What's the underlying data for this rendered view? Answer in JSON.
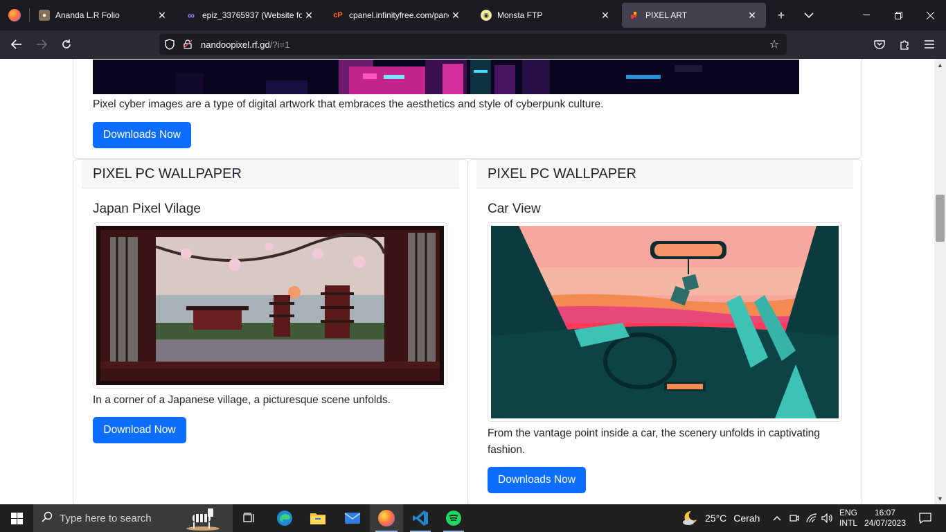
{
  "tabs": [
    {
      "title": "Ananda L.R Folio",
      "favicon": "profile-photo-icon"
    },
    {
      "title": "epiz_33765937 (Website for in",
      "favicon": "infinity-icon"
    },
    {
      "title": "cpanel.infinityfree.com/panel",
      "favicon": "cpanel-icon"
    },
    {
      "title": "Monsta FTP",
      "favicon": "monsta-icon"
    },
    {
      "title": "PIXEL ART",
      "favicon": "pixel-icon",
      "active": true
    }
  ],
  "nav": {
    "url_domain": "nandoopixel.rf.gd",
    "url_path": "/?i=1"
  },
  "page": {
    "top_card": {
      "text": "Pixel cyber images are a type of digital artwork that embraces the aesthetics and style of cyberpunk culture.",
      "button": "Downloads Now"
    },
    "left_card": {
      "header": "PIXEL PC WALLPAPER",
      "title": "Japan Pixel Vilage",
      "text": "In a corner of a Japanese village, a picturesque scene unfolds.",
      "button": "Download Now"
    },
    "right_card": {
      "header": "PIXEL PC WALLPAPER",
      "title": "Car View",
      "text": "From the vantage point inside a car, the scenery unfolds in captivating fashion.",
      "button": "Downloads Now"
    }
  },
  "taskbar": {
    "search_placeholder": "Type here to search",
    "weather_temp": "25°C",
    "weather_desc": "Cerah",
    "lang_line1": "ENG",
    "lang_line2": "INTL",
    "time": "16:07",
    "date": "24/07/2023"
  },
  "colors": {
    "primary_button": "#0d6efd",
    "tab_bar": "#1c1b22",
    "nav_bar": "#2b2a33",
    "taskbar": "#202020"
  }
}
